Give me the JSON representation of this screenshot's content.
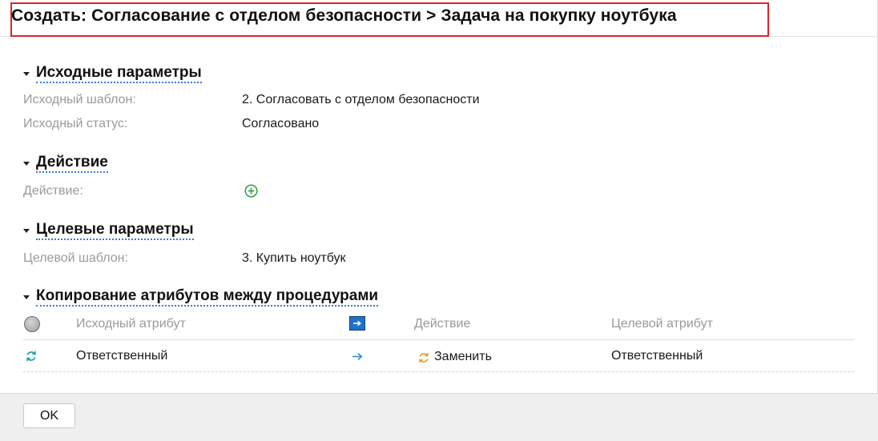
{
  "dialog": {
    "title": "Создать: Согласование с отделом безопасности > Задача на покупку ноутбука"
  },
  "sections": {
    "source": {
      "title": "Исходные параметры",
      "template_label": "Исходный шаблон:",
      "template_value": "2. Согласовать с отделом безопасности",
      "status_label": "Исходный статус:",
      "status_value": "Согласовано"
    },
    "action": {
      "title": "Действие",
      "action_label": "Действие:",
      "add_icon": "plus-circle-icon"
    },
    "target": {
      "title": "Целевые параметры",
      "template_label": "Целевой шаблон:",
      "template_value": "3. Купить ноутбук"
    },
    "copy": {
      "title": "Копирование атрибутов между процедурами",
      "columns": {
        "source": "Исходный атрибут",
        "action": "Действие",
        "target": "Целевой атрибут"
      },
      "rows": [
        {
          "source": "Ответственный",
          "action": "Заменить",
          "target": "Ответственный"
        }
      ]
    }
  },
  "footer": {
    "ok_label": "OK"
  },
  "colors": {
    "title_border": "#d9262b",
    "section_underline": "#3a7bd5",
    "add_icon": "#2e9e3e",
    "refresh_icon": "#1aa39b",
    "replace_icon": "#f0a020",
    "arrow_icon": "#2f8fd8"
  }
}
